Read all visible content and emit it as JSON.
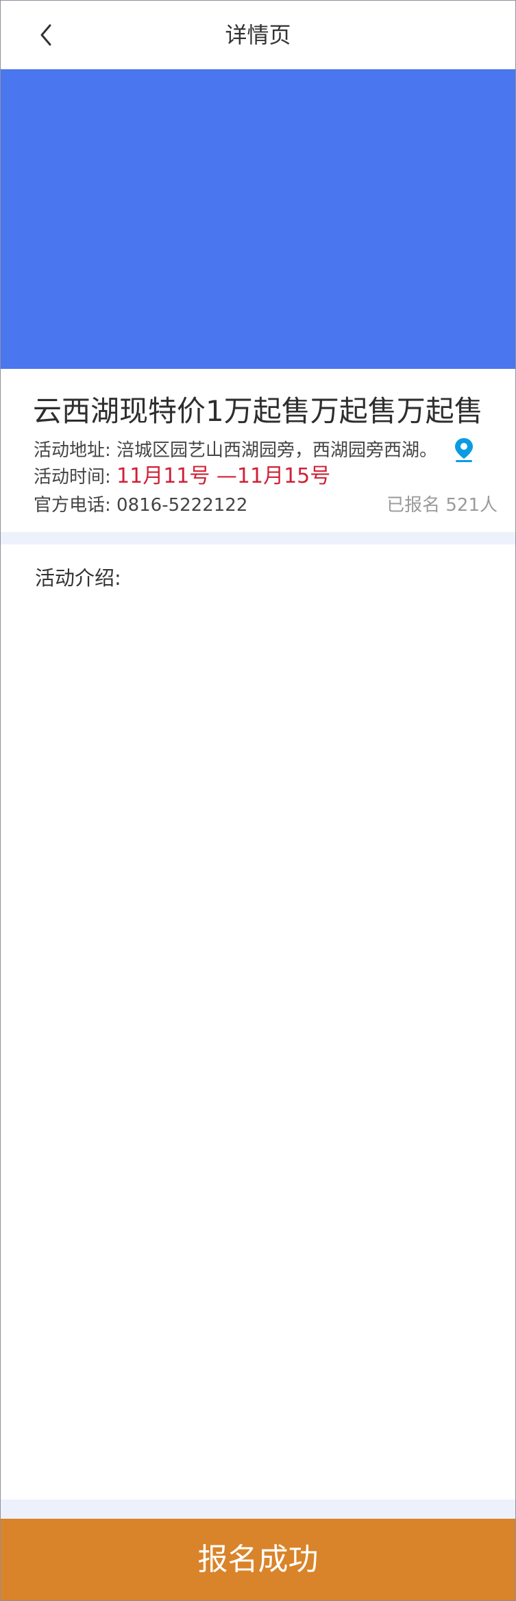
{
  "header": {
    "back_icon": "chevron-left-icon",
    "title": "详情页"
  },
  "banner": {
    "color": "#4a76ef"
  },
  "event": {
    "title": "云西湖现特价1万起售万起售万起售",
    "address_label": "活动地址:",
    "address_value": "涪城区园艺山西湖园旁，西湖园旁西湖。",
    "map_icon": "location-pin-icon",
    "time_label": "活动时间:",
    "time_value": "11月11号 —11月15号",
    "phone_label": "官方电话:",
    "phone_value": "0816-5222122",
    "signup_label": "已报名",
    "signup_count": "521人"
  },
  "intro": {
    "label": "活动介绍:"
  },
  "footer": {
    "button_label": "报名成功",
    "button_color": "#d9842a"
  },
  "colors": {
    "accent_red": "#cf2135",
    "pin_blue": "#0a9be3",
    "muted": "#9a9a9a",
    "separator": "#edf1fb"
  }
}
